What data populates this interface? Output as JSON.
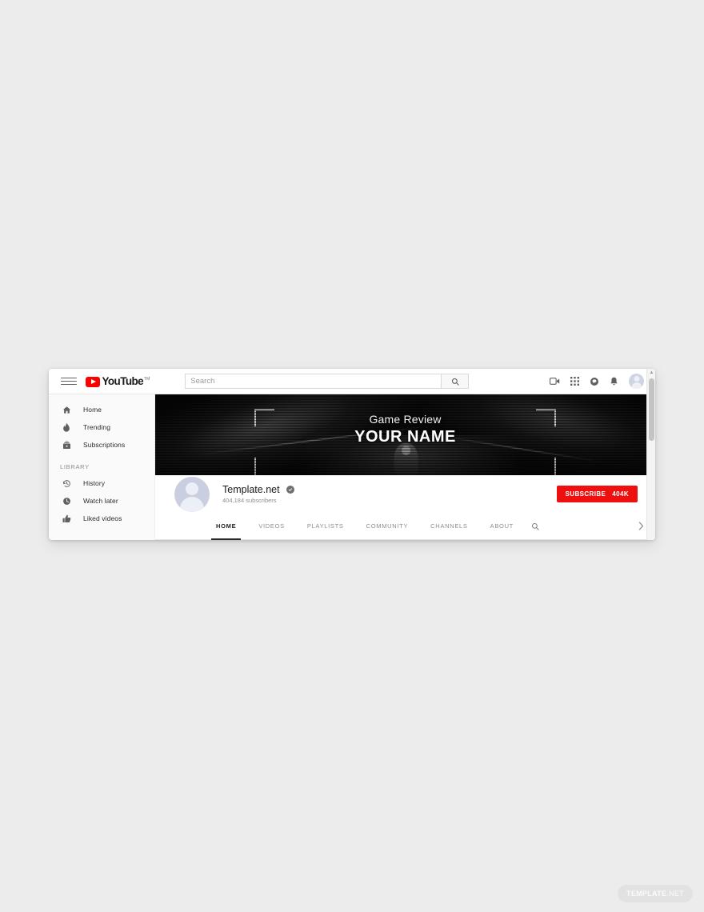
{
  "masthead": {
    "menu_icon": "hamburger-icon",
    "logo_text": "YouTube",
    "logo_tm": "TM",
    "search": {
      "placeholder": "Search",
      "value": "",
      "button_icon": "search-icon"
    },
    "right_icons": [
      {
        "name": "video-upload-icon",
        "label": "Create video"
      },
      {
        "name": "apps-grid-icon",
        "label": "YouTube apps"
      },
      {
        "name": "messages-icon",
        "label": "Messages"
      },
      {
        "name": "notifications-bell-icon",
        "label": "Notifications"
      },
      {
        "name": "account-avatar",
        "label": "Account"
      }
    ]
  },
  "sidebar": {
    "items": [
      {
        "label": "Home",
        "icon": "home-icon"
      },
      {
        "label": "Trending",
        "icon": "flame-icon"
      },
      {
        "label": "Subscriptions",
        "icon": "subscriptions-icon"
      }
    ],
    "section_label": "LIBRARY",
    "library_items": [
      {
        "label": "History",
        "icon": "history-icon"
      },
      {
        "label": "Watch later",
        "icon": "clock-icon"
      },
      {
        "label": "Liked videos",
        "icon": "thumbs-up-icon"
      }
    ]
  },
  "banner": {
    "subtitle": "Game Review",
    "title": "YOUR NAME",
    "background_color": "#0a0a0a",
    "bracket_color": "#ffffff"
  },
  "channel": {
    "name": "Template.net",
    "verified": true,
    "subscribers": "404,184 subscribers",
    "subscribe_label": "SUBSCRIBE",
    "subscribe_count": "404K",
    "subscribe_color": "#ee0f0f"
  },
  "tabs": {
    "items": [
      {
        "label": "HOME",
        "active": true
      },
      {
        "label": "VIDEOS",
        "active": false
      },
      {
        "label": "PLAYLISTS",
        "active": false
      },
      {
        "label": "COMMUNITY",
        "active": false
      },
      {
        "label": "CHANNELS",
        "active": false
      },
      {
        "label": "ABOUT",
        "active": false
      }
    ],
    "search_icon": "search-icon",
    "overflow_icon": "chevron-right-icon"
  },
  "scrollbar": {
    "up_arrow": "▲"
  },
  "watermark": {
    "bold": "TEMPLATE",
    "thin": ".NET"
  }
}
